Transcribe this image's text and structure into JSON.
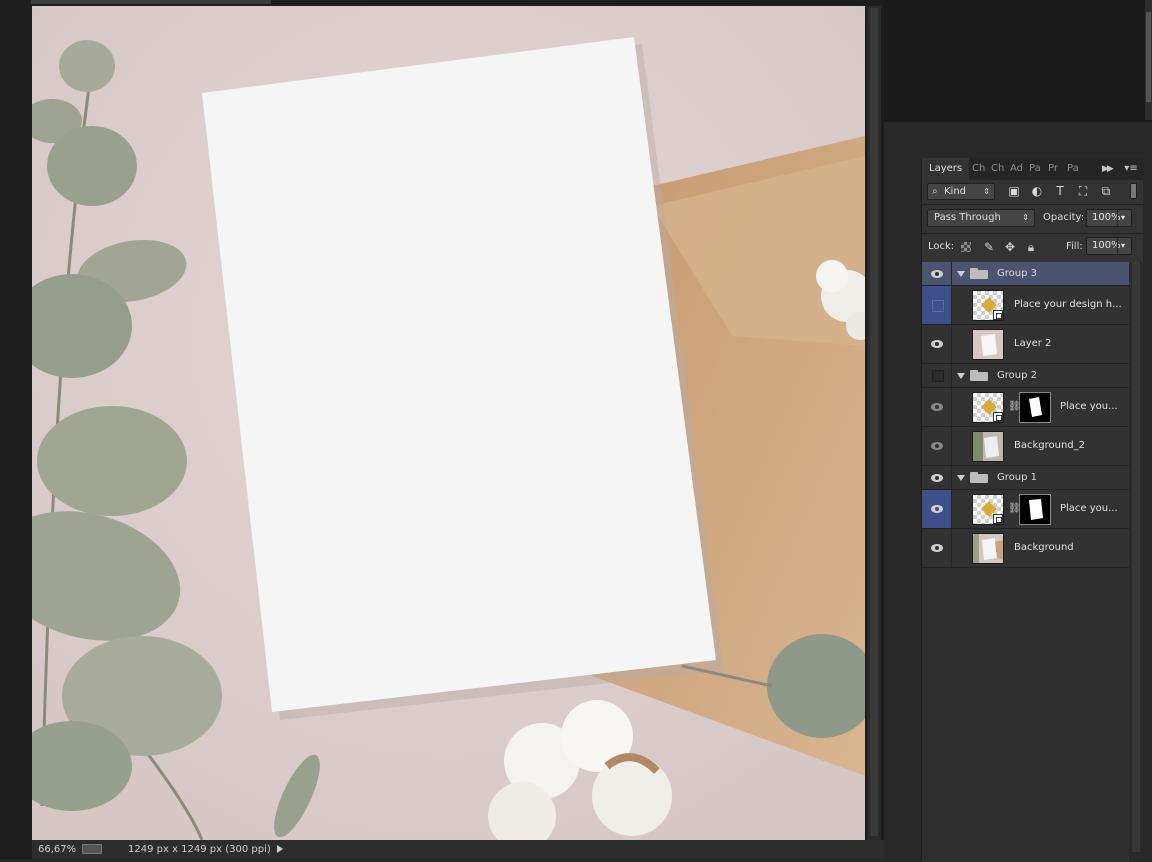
{
  "document": {
    "zoom": "66,67%",
    "size_info": "1249 px x 1249 px (300 ppi)",
    "canvas_description_colors": {
      "background": "#dccfcd",
      "card": "#f4f4f4",
      "envelope": "#c9a37d",
      "leaf": "#97a18e"
    }
  },
  "layers_panel": {
    "tabs": [
      "Layers",
      "Ch",
      "Ch",
      "Ad",
      "Pa",
      "Pr",
      "Pa"
    ],
    "filter": {
      "kind_label": "Kind"
    },
    "blend_mode": "Pass Through",
    "opacity_label": "Opacity:",
    "opacity_value": "100%",
    "lock_label": "Lock:",
    "fill_label": "Fill:",
    "fill_value": "100%",
    "layers": [
      {
        "name": "Group 3",
        "type": "group",
        "visible": true,
        "selected": true
      },
      {
        "name": "Place your design h...",
        "type": "smart",
        "visible": false,
        "highlight": true
      },
      {
        "name": "Layer 2",
        "type": "pixel",
        "visible": true
      },
      {
        "name": "Group 2",
        "type": "group",
        "visible": false
      },
      {
        "name": "Place you...",
        "type": "smart-mask",
        "visible": true,
        "dim": true
      },
      {
        "name": "Background_2",
        "type": "pixel",
        "visible": true,
        "dim": true
      },
      {
        "name": "Group 1",
        "type": "group",
        "visible": true
      },
      {
        "name": "Place you...",
        "type": "smart-mask",
        "visible": true,
        "highlight": true
      },
      {
        "name": "Background",
        "type": "pixel",
        "visible": true
      }
    ]
  }
}
